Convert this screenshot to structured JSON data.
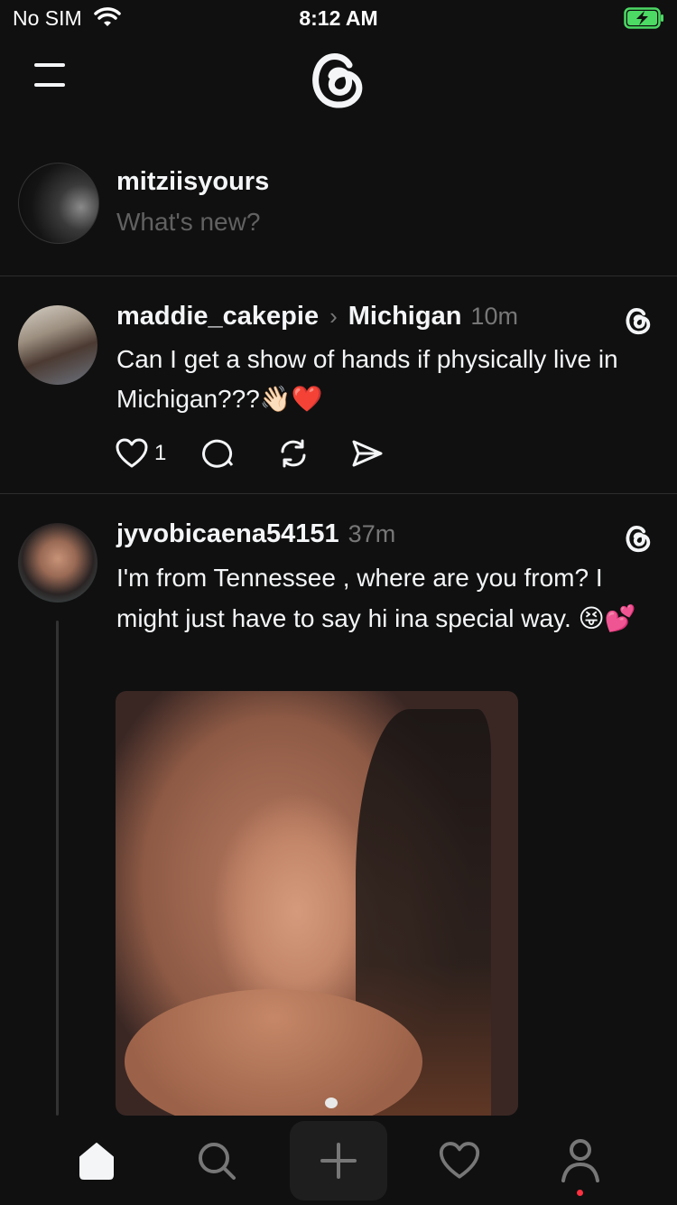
{
  "status_bar": {
    "carrier": "No SIM",
    "time": "8:12 AM"
  },
  "header": {
    "logo_icon": "threads-logo-icon",
    "menu_icon": "menu-icon"
  },
  "composer": {
    "username": "mitziisyours",
    "placeholder": "What's new?"
  },
  "posts": [
    {
      "username": "maddie_cakepie",
      "topic": "Michigan",
      "time": "10m",
      "text": "Can I get a show of hands if physically live in Michigan???👋🏻❤️",
      "like_count": "1"
    },
    {
      "username": "jyvobicaena54151",
      "time": "37m",
      "text": "I'm from Tennessee , where are you from? I might just have to say hi ina special way. 😝💕"
    }
  ],
  "tabbar": {
    "items": [
      "home-icon",
      "search-icon",
      "compose-icon",
      "activity-icon",
      "profile-icon"
    ]
  },
  "colors": {
    "background": "#101010",
    "text": "#f3f5f7",
    "muted": "#777777",
    "notification": "#ff3040"
  }
}
